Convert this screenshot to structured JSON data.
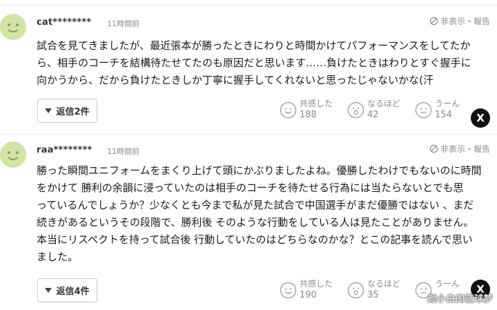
{
  "comments": [
    {
      "username": "cat********",
      "time": "11時間前",
      "report": "非表示・報告",
      "lines": [
        "試合を見てきましたが、最近張本が勝ったときにわりと時間かけてパフォーマンスをしてたか",
        "ら、相手のコーチを結構待たせてたのも原因だと思います……負けたときはわりとすぐ握手に",
        "向かうから、だから負けたときしか丁寧に握手してくれないと思ったじゃないかな(汗"
      ],
      "reply_label": "返信2件",
      "reactions": [
        {
          "label": "共感した",
          "count": "188",
          "icon": "smile-face-icon"
        },
        {
          "label": "なるほど",
          "count": "42",
          "icon": "surprised-face-icon"
        },
        {
          "label": "うーん",
          "count": "154",
          "icon": "thinking-face-icon"
        }
      ],
      "share_icon": "X"
    },
    {
      "username": "raa********",
      "time": "11時間前",
      "report": "非表示・報告",
      "lines": [
        "勝った瞬間ユニフォームをまくり上げて頭にかぶりましたよね。優勝したわけでもないのに時間",
        "をかけて 勝利の余韻に浸っていたのは相手のコーチを待たせる行為には当たらないとでも思",
        "っているんでしょうか？少なくとも今まで私が見た試合で中国選手がまだ優勝ではない 、まだ",
        "続きがあるというその段階で、勝利後 そのような行動をしている人は見たことがありません。",
        "本当にリスペクトを持って試合後 行動していたのはどちらなのかな？とこの記事を読んで思い",
        "ました。"
      ],
      "reply_label": "返信4件",
      "reactions": [
        {
          "label": "共感した",
          "count": "190",
          "icon": "smile-face-icon"
        },
        {
          "label": "なるほど",
          "count": "35",
          "icon": "surprised-face-icon"
        },
        {
          "label": "うーん",
          "count": "",
          "icon": "thinking-face-icon"
        }
      ],
      "share_icon": "X"
    }
  ],
  "watermark": "颜小白的篮球梦",
  "colors": {
    "avatar": "#d2e4a4",
    "text": "#1a1a1a",
    "muted": "#8a8a8a",
    "border": "#c9c9c9"
  }
}
